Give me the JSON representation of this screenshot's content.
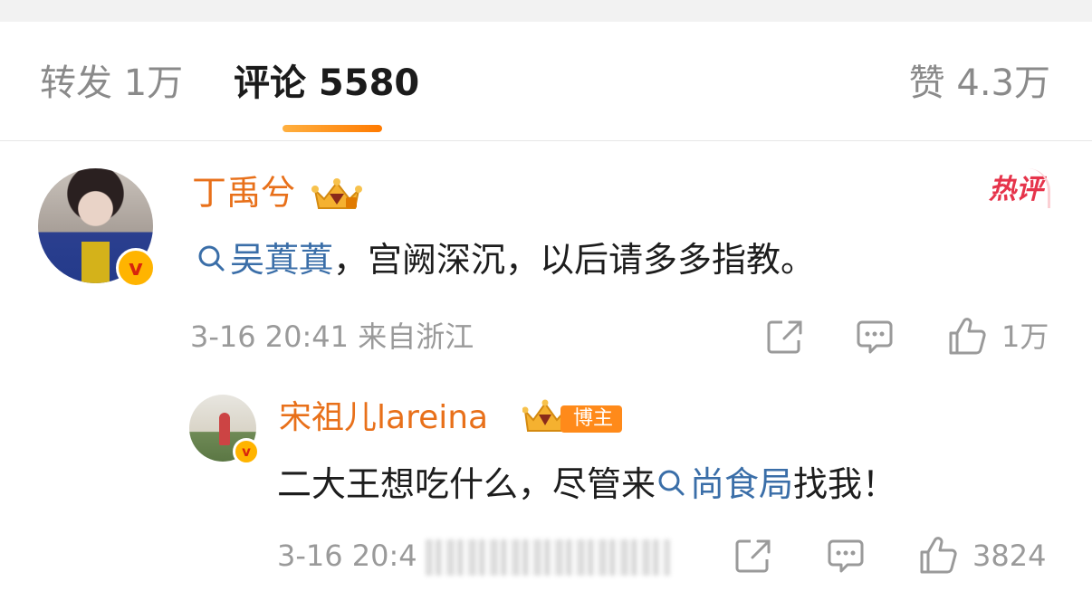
{
  "tabs": {
    "repost": "转发 1万",
    "comments": "评论 5580",
    "likes": "赞 4.3万"
  },
  "comments": [
    {
      "username": "丁禹兮",
      "verified_mark": "v",
      "hot_label": "热评",
      "topic": "吴蒖蒖",
      "text_after": "，宫阙深沉，以后请多多指教。",
      "meta": "3-16 20:41 来自浙江",
      "likes": "1万"
    }
  ],
  "reply": {
    "username": "宋祖儿lareina",
    "verified_mark": "v",
    "badge_label": "博主",
    "text_before": "二大王想吃什么，尽管来",
    "topic": "尚食局",
    "text_after": "找我！",
    "meta_visible": "3-16 20:4",
    "likes": "3824"
  },
  "colors": {
    "accent_orange": "#e8701a",
    "topic_blue": "#3a6ea8",
    "hot_red": "#e6344b"
  },
  "icons": [
    "search-icon",
    "share-icon",
    "comment-icon",
    "thumbs-up-icon",
    "crown-icon",
    "verified-icon"
  ]
}
